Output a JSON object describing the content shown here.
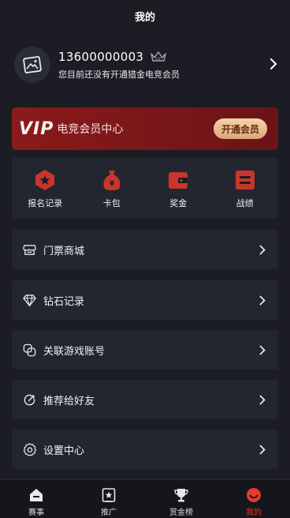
{
  "header": {
    "title": "我的"
  },
  "profile": {
    "phone": "13600000003",
    "status": "您目前还没有开通猎金电竞会员"
  },
  "banner": {
    "logo": "VIP",
    "title": "电竞会员中心",
    "button": "开通会员"
  },
  "quick": {
    "items": [
      {
        "label": "报名记录",
        "icon": "star-hexagon-icon"
      },
      {
        "label": "卡包",
        "icon": "money-bag-icon"
      },
      {
        "label": "奖金",
        "icon": "wallet-icon"
      },
      {
        "label": "战绩",
        "icon": "record-icon"
      }
    ]
  },
  "menu": {
    "items": [
      {
        "label": "门票商城",
        "icon": "store-icon"
      },
      {
        "label": "钻石记录",
        "icon": "diamond-icon"
      },
      {
        "label": "关联游戏账号",
        "icon": "link-icon"
      },
      {
        "label": "推荐给好友",
        "icon": "share-icon"
      },
      {
        "label": "设置中心",
        "icon": "gear-icon"
      }
    ]
  },
  "tabs": {
    "items": [
      {
        "label": "赛事",
        "icon": "home-icon"
      },
      {
        "label": "推广",
        "icon": "promote-icon"
      },
      {
        "label": "赏金榜",
        "icon": "trophy-icon"
      },
      {
        "label": "我的",
        "icon": "profile-icon",
        "active": true
      }
    ]
  },
  "colors": {
    "background": "#1b1c24",
    "card": "#23252f",
    "accent": "#c9352b",
    "active_tab": "#e53a2e",
    "vip_button": "#dba877"
  }
}
